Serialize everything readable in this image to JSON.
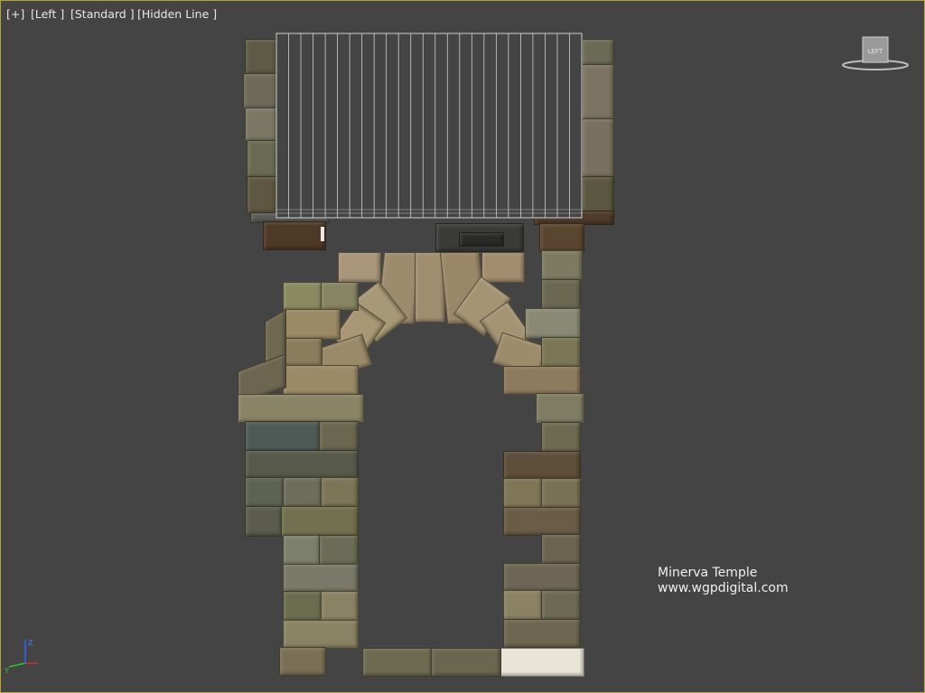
{
  "viewport": {
    "labels": {
      "plus": "[+]",
      "view": "[Left ]",
      "shading": "[Standard ]",
      "mode": "[Hidden Line ]"
    },
    "border_color": "#b9a23c",
    "background_color": "#444444"
  },
  "viewcube": {
    "face_label": "LEFT"
  },
  "axis_gizmo": {
    "z_label": "Z",
    "y_label": "Y"
  },
  "credit": {
    "line1": "Minerva Temple",
    "line2": "www.wgpdigital.com"
  }
}
